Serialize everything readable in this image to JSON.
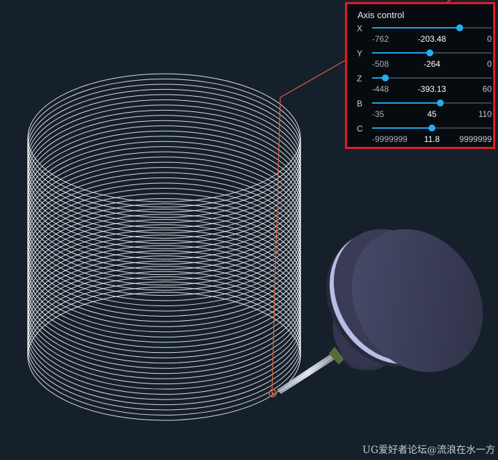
{
  "panel": {
    "title": "Axis control",
    "axes": [
      {
        "name": "X",
        "min": "-762",
        "value": "-203.48",
        "max": "0",
        "fraction": 0.73
      },
      {
        "name": "Y",
        "min": "-508",
        "value": "-264",
        "max": "0",
        "fraction": 0.48
      },
      {
        "name": "Z",
        "min": "-448",
        "value": "-393.13",
        "max": "60",
        "fraction": 0.11
      },
      {
        "name": "B",
        "min": "-35",
        "value": "45",
        "max": "110",
        "fraction": 0.57
      },
      {
        "name": "C",
        "min": "-9999999",
        "value": "11.8",
        "max": "9999999",
        "fraction": 0.5
      }
    ]
  },
  "watermark": "UG爱好者论坛@流浪在水一方",
  "colors": {
    "background": "#15202b",
    "panel_border": "#e51a2a",
    "slider_accent": "#1fa6e6",
    "toolpath": "#ffffff",
    "tool_body": "#3a3d57",
    "leader_line": "#e0603a"
  }
}
